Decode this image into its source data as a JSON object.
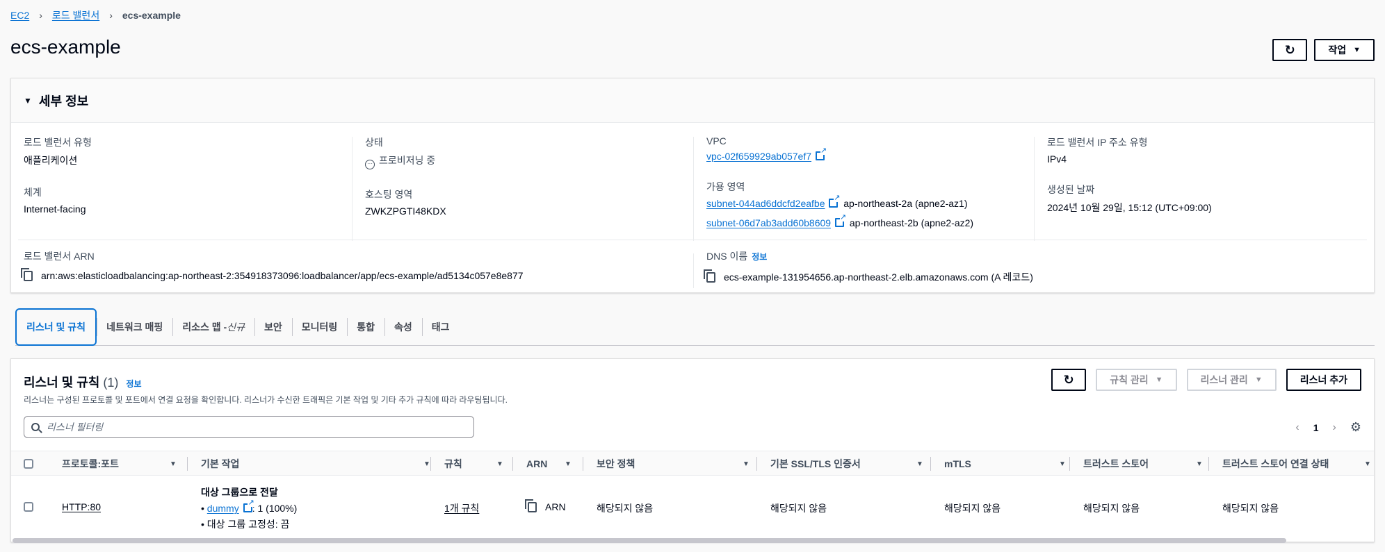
{
  "breadcrumb": {
    "items": [
      "EC2",
      "로드 밸런서"
    ],
    "current": "ecs-example"
  },
  "page": {
    "title": "ecs-example",
    "action_label": "작업"
  },
  "details": {
    "header": "세부 정보",
    "type_label": "로드 밸런서 유형",
    "type_value": "애플리케이션",
    "scheme_label": "체계",
    "scheme_value": "Internet-facing",
    "status_label": "상태",
    "status_value": "프로비저닝 중",
    "hosted_zone_label": "호스팅 영역",
    "hosted_zone_value": "ZWKZPGTI48KDX",
    "vpc_label": "VPC",
    "vpc_value": "vpc-02f659929ab057ef7",
    "az_label": "가용 영역",
    "subnets": [
      {
        "id": "subnet-044ad6ddcfd2eafbe",
        "zone": "ap-northeast-2a (apne2-az1)"
      },
      {
        "id": "subnet-06d7ab3add60b8609",
        "zone": "ap-northeast-2b (apne2-az2)"
      }
    ],
    "ip_type_label": "로드 밸런서 IP 주소 유형",
    "ip_type_value": "IPv4",
    "created_label": "생성된 날짜",
    "created_value": "2024년 10월 29일, 15:12 (UTC+09:00)",
    "arn_label": "로드 밸런서 ARN",
    "arn_value": "arn:aws:elasticloadbalancing:ap-northeast-2:354918373096:loadbalancer/app/ecs-example/ad5134c057e8e877",
    "dns_label": "DNS 이름",
    "dns_info": "정보",
    "dns_value": "ecs-example-131954656.ap-northeast-2.elb.amazonaws.com (A 레코드)"
  },
  "tabs": [
    {
      "label": "리스너 및 규칙"
    },
    {
      "label": "네트워크 매핑"
    },
    {
      "label": "리소스 맵 - ",
      "tag": "신규"
    },
    {
      "label": "보안"
    },
    {
      "label": "모니터링"
    },
    {
      "label": "통합"
    },
    {
      "label": "속성"
    },
    {
      "label": "태그"
    }
  ],
  "listeners": {
    "title": "리스너 및 규칙",
    "count": "(1)",
    "info": "정보",
    "description": "리스너는 구성된 프로토콜 및 포트에서 연결 요청을 확인합니다. 리스너가 수신한 트래픽은 기본 작업 및 기타 추가 규칙에 따라 라우팅됩니다.",
    "manage_rules": "규칙 관리",
    "manage_listeners": "리스너 관리",
    "add_listener": "리스너 추가",
    "search_placeholder": "리스너 필터링",
    "page": "1",
    "columns": [
      "프로토콜:포트",
      "기본 작업",
      "규칙",
      "ARN",
      "보안 정책",
      "기본 SSL/TLS 인증서",
      "mTLS",
      "트러스트 스토어",
      "트러스트 스토어 연결 상태"
    ],
    "row": {
      "protocol": "HTTP:80",
      "action_title": "대상 그룹으로 전달",
      "target_group": "dummy",
      "weight": ": 1 (100%)",
      "stickiness": "대상 그룹 고정성: 끔",
      "rules": "1개 규칙",
      "arn": "ARN",
      "security_policy": "해당되지 않음",
      "ssl_cert": "해당되지 않음",
      "mtls": "해당되지 않음",
      "trust_store": "해당되지 않음",
      "trust_store_status": "해당되지 않음"
    }
  }
}
